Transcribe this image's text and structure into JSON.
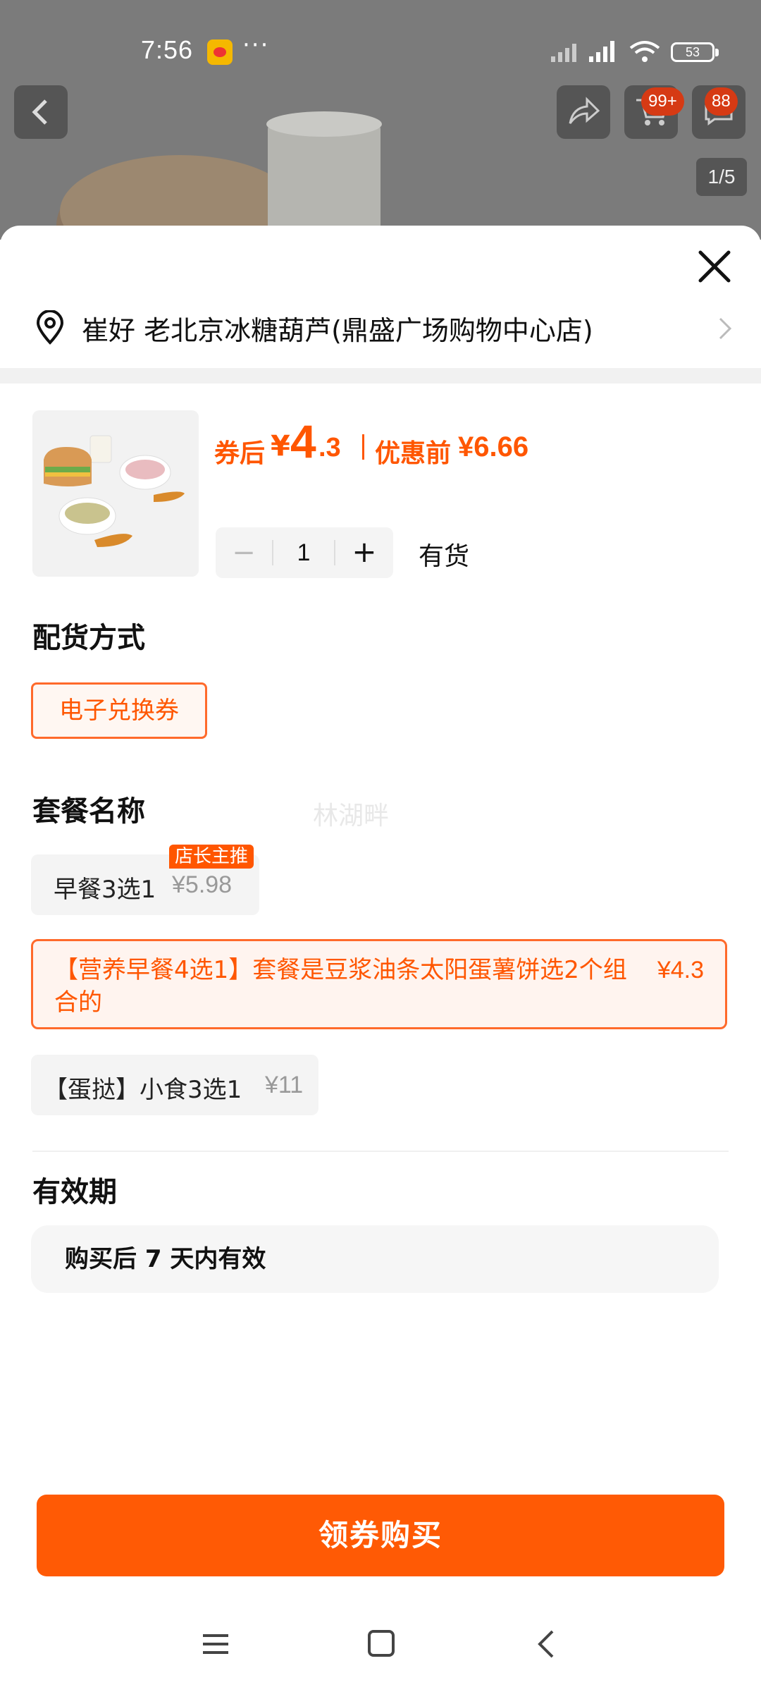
{
  "status_bar": {
    "time": "7:56",
    "battery": "53",
    "more": "···"
  },
  "header": {
    "cart_badge": "99+",
    "msg_badge": "88",
    "page_indicator": "1/5"
  },
  "store": {
    "name": "崔好 老北京冰糖葫芦(鼎盛广场购物中心店)"
  },
  "price": {
    "after_label": "券后",
    "after_yen": "¥",
    "after_int": "4",
    "after_dec": ".3",
    "before_label": "优惠前",
    "before_value": "¥6.66"
  },
  "quantity": {
    "minus": "−",
    "value": "1",
    "plus": "+",
    "stock": "有货"
  },
  "delivery": {
    "title": "配货方式",
    "selected": "电子兑换券"
  },
  "package": {
    "title": "套餐名称",
    "watermark": "林湖畔",
    "options": [
      {
        "name": "早餐3选1",
        "price": "¥5.98",
        "tag": "店长主推",
        "selected": false
      },
      {
        "name": "【营养早餐4选1】套餐是豆浆油条太阳蛋薯饼选2个组合的",
        "price": "¥4.3",
        "selected": true
      },
      {
        "name": "【蛋挞】小食3选1",
        "price": "¥11",
        "selected": false
      }
    ]
  },
  "validity": {
    "title": "有效期",
    "text": "购买后 7 天内有效"
  },
  "buy_button": {
    "label": "领券购买"
  },
  "colors": {
    "accent": "#ff5600",
    "button": "#ff5a05"
  }
}
